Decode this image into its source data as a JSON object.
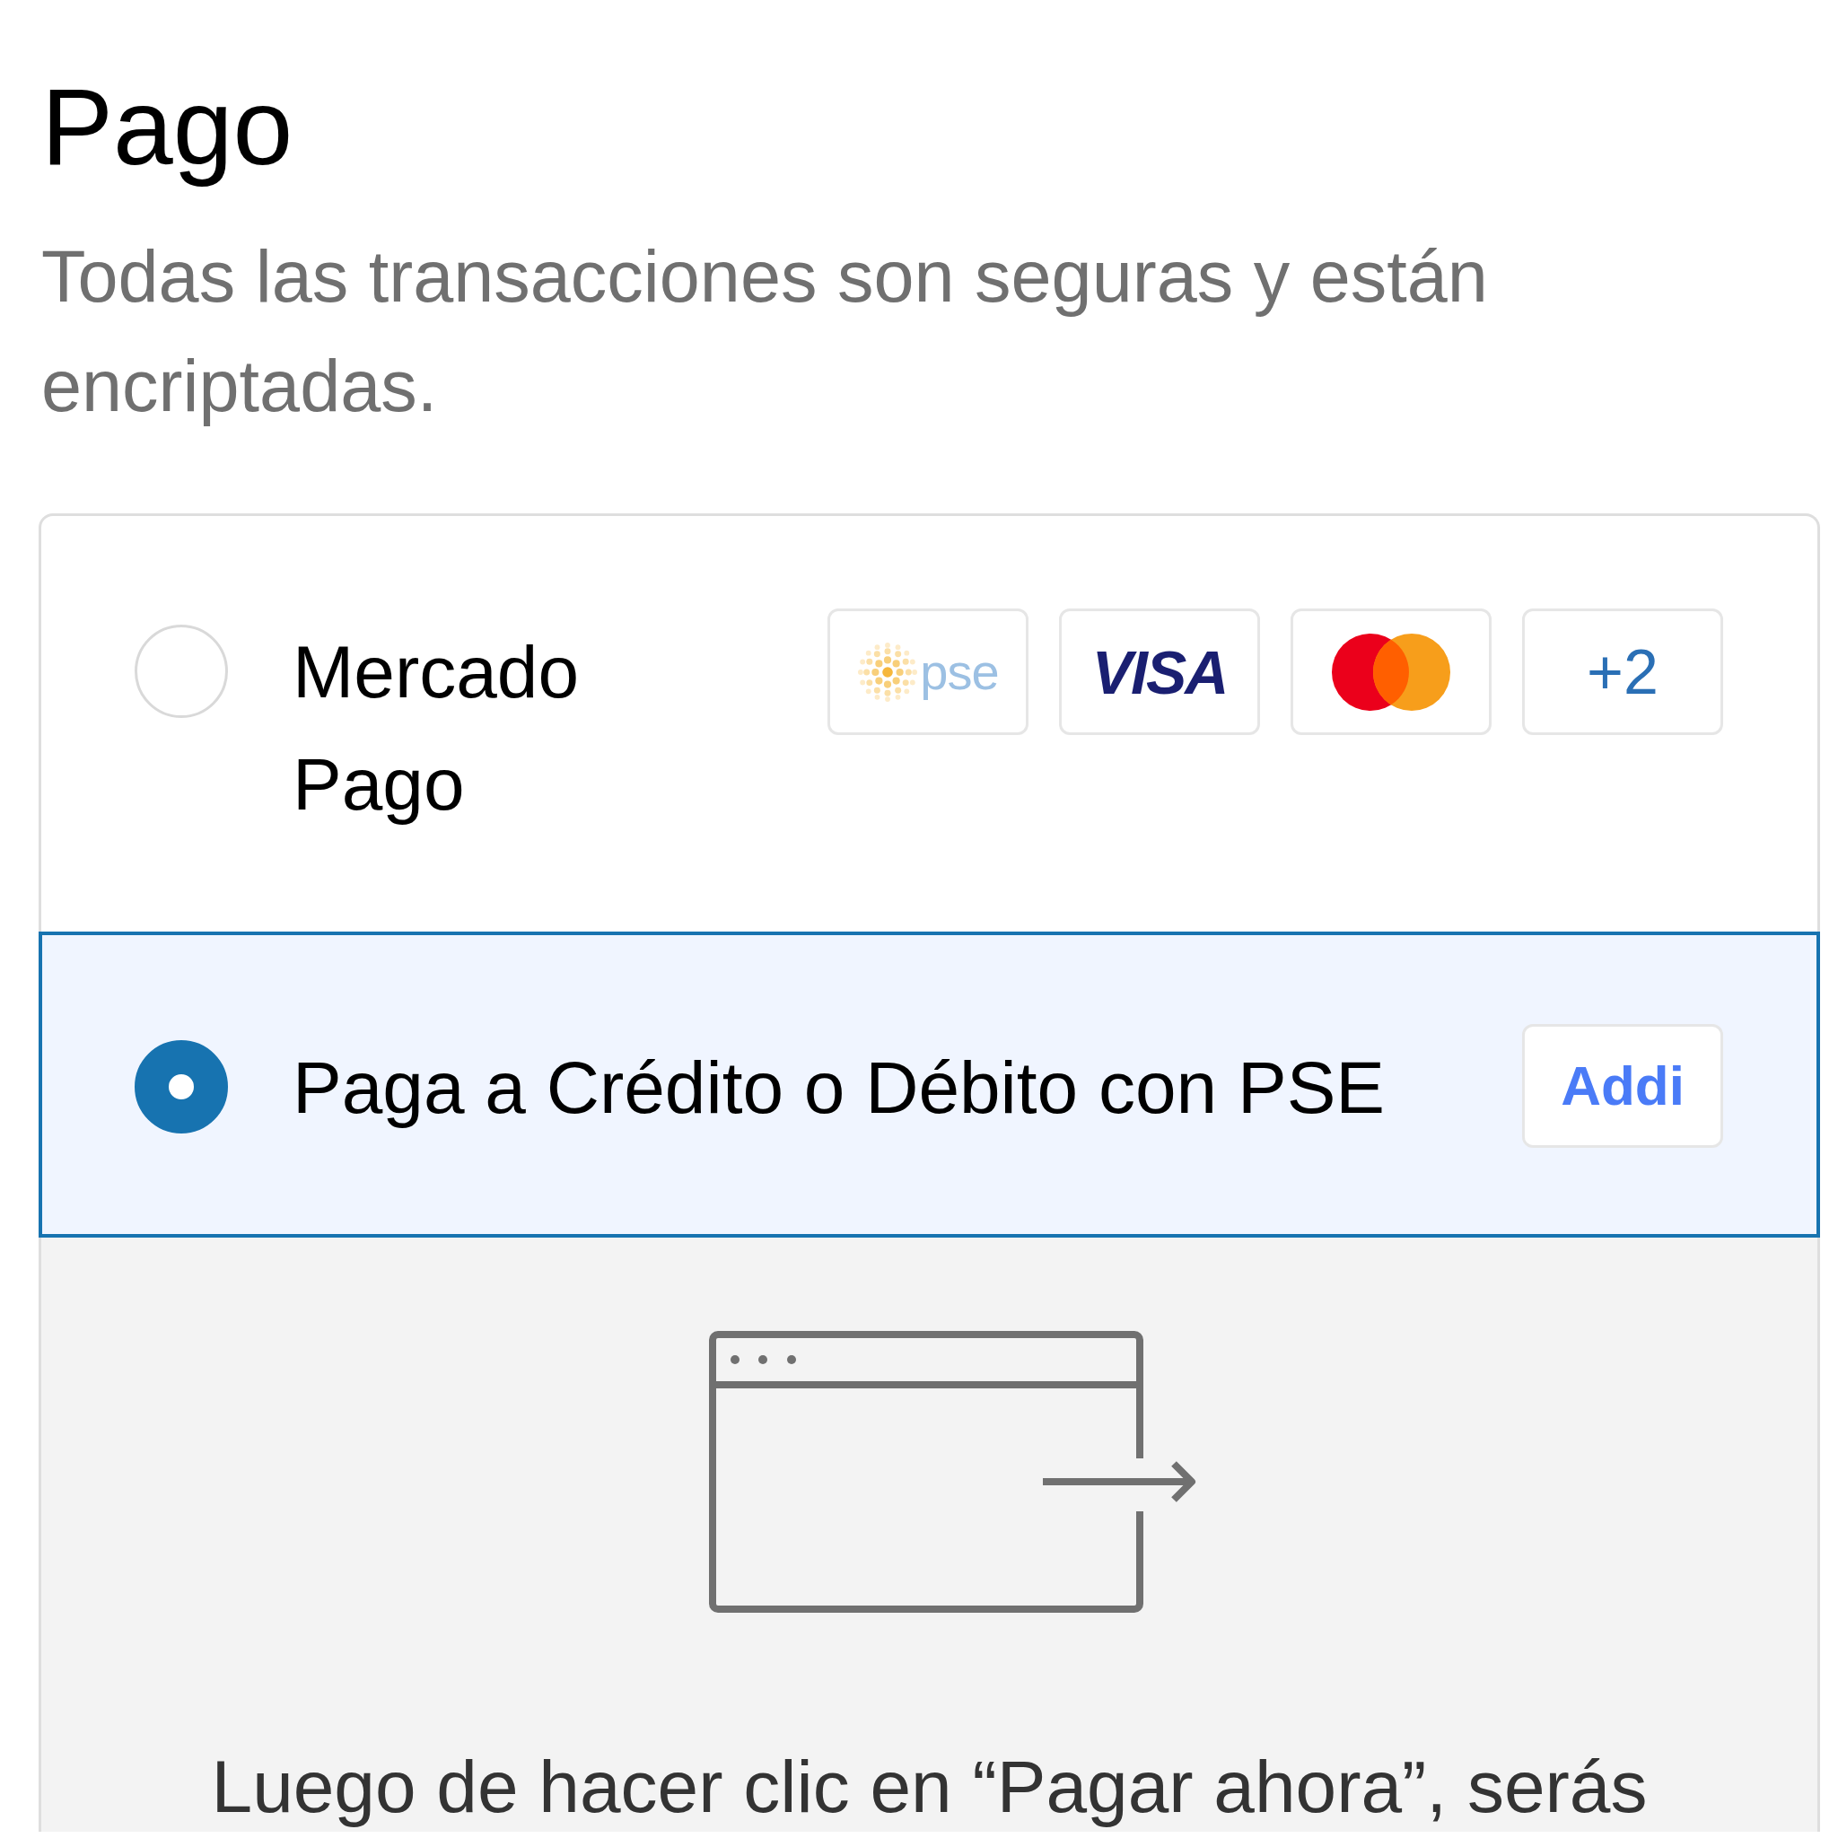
{
  "heading": {
    "title": "Pago",
    "subtitle": "Todas las transacciones son seguras y están encriptadas."
  },
  "payment_methods": [
    {
      "label": "Mercado Pago",
      "selected": false,
      "badges": [
        {
          "kind": "pse",
          "text": "pse"
        },
        {
          "kind": "visa",
          "text": "VISA"
        },
        {
          "kind": "mastercard"
        },
        {
          "kind": "more",
          "text": "+2"
        }
      ]
    },
    {
      "label": "Paga a Crédito o Débito con PSE",
      "selected": true,
      "badges": [
        {
          "kind": "addi",
          "text": "Addi"
        }
      ]
    }
  ],
  "redirect_notice": {
    "text": "Luego de hacer clic en “Pagar ahora”, serás"
  }
}
